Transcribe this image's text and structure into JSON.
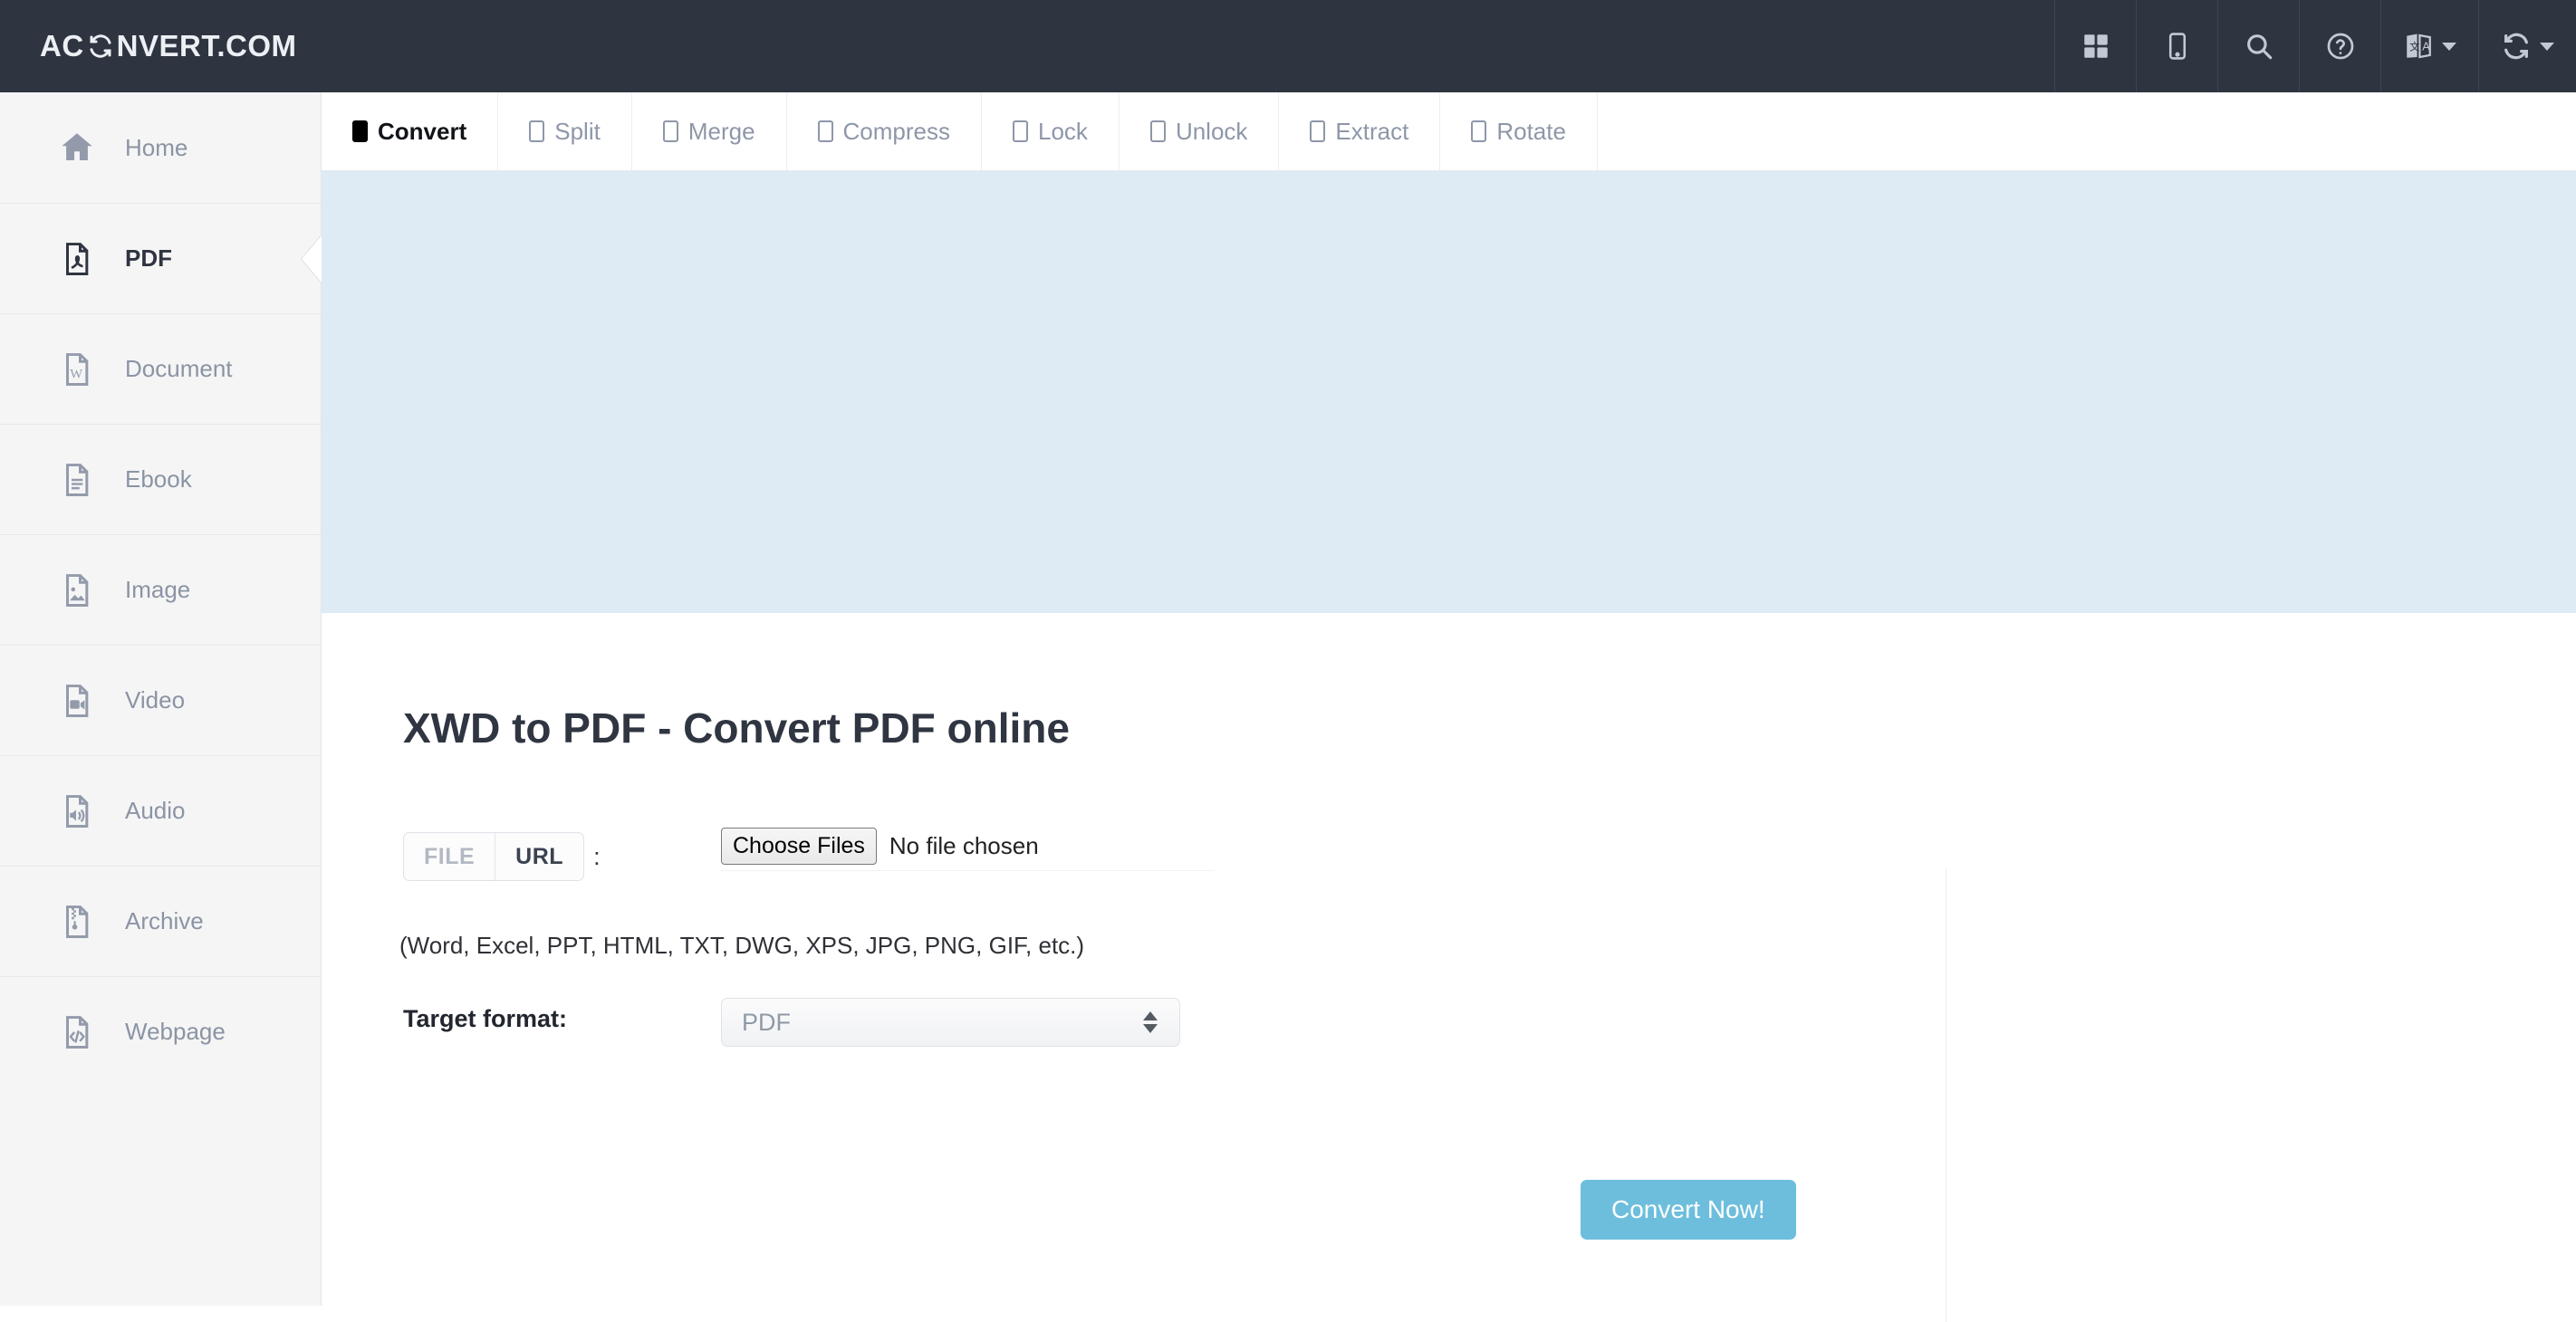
{
  "brand": {
    "text_before": "AC",
    "icon": "refresh-icon",
    "text_after": "NVERT.COM"
  },
  "topbar": {
    "actions": [
      {
        "name": "apps-grid-icon",
        "label": "Apps"
      },
      {
        "name": "mobile-icon",
        "label": "Mobile"
      },
      {
        "name": "search-icon",
        "label": "Search"
      },
      {
        "name": "help-icon",
        "label": "Help"
      },
      {
        "name": "translate-icon",
        "label": "Language"
      },
      {
        "name": "convert-icon",
        "label": "Convert"
      }
    ]
  },
  "sidebar": {
    "items": [
      {
        "label": "Home",
        "icon": "home-icon",
        "active": false
      },
      {
        "label": "PDF",
        "icon": "pdf-file-icon",
        "active": true
      },
      {
        "label": "Document",
        "icon": "word-file-icon",
        "active": false
      },
      {
        "label": "Ebook",
        "icon": "ebook-file-icon",
        "active": false
      },
      {
        "label": "Image",
        "icon": "image-file-icon",
        "active": false
      },
      {
        "label": "Video",
        "icon": "video-file-icon",
        "active": false
      },
      {
        "label": "Audio",
        "icon": "audio-file-icon",
        "active": false
      },
      {
        "label": "Archive",
        "icon": "archive-file-icon",
        "active": false
      },
      {
        "label": "Webpage",
        "icon": "code-file-icon",
        "active": false
      }
    ]
  },
  "tabs": [
    {
      "label": "Convert",
      "active": true
    },
    {
      "label": "Split",
      "active": false
    },
    {
      "label": "Merge",
      "active": false
    },
    {
      "label": "Compress",
      "active": false
    },
    {
      "label": "Lock",
      "active": false
    },
    {
      "label": "Unlock",
      "active": false
    },
    {
      "label": "Extract",
      "active": false
    },
    {
      "label": "Rotate",
      "active": false
    }
  ],
  "main": {
    "title": "XWD to PDF - Convert PDF online",
    "source_toggle": {
      "file_label": "FILE",
      "url_label": "URL",
      "separator": ":"
    },
    "file_input": {
      "button_label": "Choose Files",
      "status": "No file chosen",
      "hint": "(Word, Excel, PPT, HTML, TXT, DWG, XPS, JPG, PNG, GIF, etc.)"
    },
    "target_format": {
      "label": "Target format:",
      "value": "PDF"
    },
    "submit_label": "Convert Now!"
  },
  "colors": {
    "topbar_bg": "#2e3440",
    "sidebar_bg": "#f5f5f6",
    "banner_bg": "#deeaf4",
    "accent_button": "#6dbedd",
    "muted_text": "#8b94a3"
  }
}
